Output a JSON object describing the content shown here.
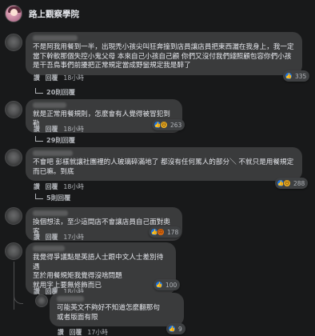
{
  "group": {
    "title": "路上觀察學院"
  },
  "comments": [
    {
      "text": "不是阿我用餐到一半，出現禿小孩尖叫狂奔撞到店員讓店員把東西灑在我身上，我一定當下幹軟那個失控小鬼父母 本來自己小孩自己顧 你們又沒付我們錢照顧包容你們小孩 是干吾鳥事們前擾把正常規定當成野蠻規定我是醉了",
      "like_label": "讚",
      "reply_label": "回覆",
      "time": "18小時",
      "reactions": [
        "like-icon"
      ],
      "reaction_count": "335",
      "replies_label": "20則回覆"
    },
    {
      "text": "就是正常用餐規則，怎麼會有人覺得被冒犯到勒",
      "like_label": "讚",
      "reply_label": "回覆",
      "time": "18小時",
      "reactions": [
        "like-icon",
        "haha-icon"
      ],
      "reaction_count": "263",
      "replies_label": "29則回覆"
    },
    {
      "text": "不會吧 彭樣就讓社團裡的人玻璃碎滿地了 都沒有任何罵人的部分＼ 不就只是用餐規定而已嘛。到底",
      "like_label": "讚",
      "reply_label": "回覆",
      "time": "18小時",
      "reactions": [
        "like-icon",
        "haha-icon"
      ],
      "reaction_count": "288",
      "replies_label": "5則回覆"
    },
    {
      "text": "換個想法，至少這間店不會讓店員自己面對奧客",
      "like_label": "讚",
      "reply_label": "回覆",
      "time": "17小時",
      "reactions": [
        "like-icon",
        "angry-icon"
      ],
      "reaction_count": "178"
    },
    {
      "text": "我覺得爭議點是英語人士跟中文人士差別待遇\n至於用餐規矩我覺得沒啥問題\n就用字上要無修飾而已",
      "like_label": "讚",
      "reply_label": "回覆",
      "time": "18小時",
      "reactions": [
        "like-icon"
      ],
      "reaction_count": "100"
    },
    {
      "text": "可能英文不夠好不知道怎麼翻那句\n或者版面有限",
      "like_label": "讚",
      "reply_label": "回覆",
      "time": "17小時",
      "reactions": [
        "like-icon"
      ],
      "reaction_count": "9"
    }
  ]
}
